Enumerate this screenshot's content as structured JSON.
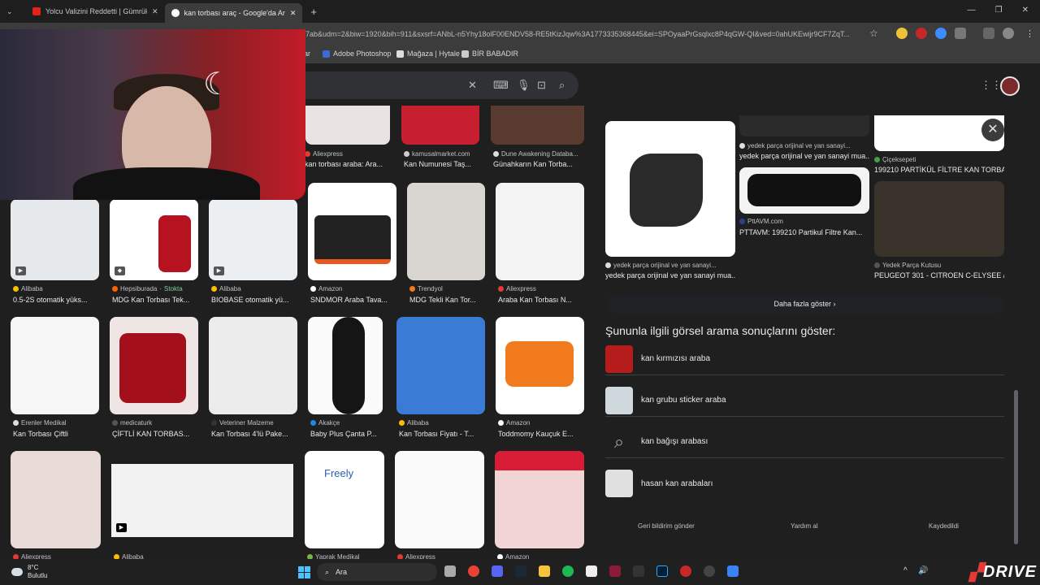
{
  "browser": {
    "tabs": [
      {
        "title": "Yolcu Valizini Reddetti | Gümrük"
      },
      {
        "title": "kan torbası araç - Google'da Ar"
      }
    ],
    "url_fragment": "d87ab&udm=2&biw=1920&bih=911&sxsrf=ANbL-n5Yhy18olF00ENDV58-RE5tKizJqw%3A1773335368445&ei=SPOyaaPrGsqlxc8P4qGW-QI&ved=0ahUKEwijr9CF7ZqT...",
    "bookmarks": [
      "lar",
      "Adobe Photoshop",
      "Mağaza | Hytale",
      "BİR BABADIR"
    ]
  },
  "results_row1": [
    {
      "source": "Aliexpress",
      "title": "kan torbası araba: Ara..."
    },
    {
      "source": "kamusalmarket.com",
      "title": "Kan Numunesi Taş..."
    },
    {
      "source": "Dune Awakening Databa...",
      "title": "Günahkarın Kan Torba..."
    }
  ],
  "results_row2": [
    {
      "source": "Alibaba",
      "title": "0.5-2S otomatik yüks..."
    },
    {
      "source": "Hepsiburada",
      "badge": "Stokta",
      "title": "MDG Kan Torbası Tek..."
    },
    {
      "source": "Alibaba",
      "title": "BIOBASE otomatik yü..."
    },
    {
      "source": "Amazon",
      "title": "SNDMOR Araba Tava..."
    },
    {
      "source": "Trendyol",
      "title": "MDG Tekli Kan Tor..."
    },
    {
      "source": "Aliexpress",
      "title": "Araba Kan Torbası N..."
    }
  ],
  "results_row3": [
    {
      "source": "Erenler Medikal",
      "title": "Kan Torbası Çiftli"
    },
    {
      "source": "medicaturk",
      "title": "ÇİFTLİ KAN TORBAS..."
    },
    {
      "source": "Veteriner Malzeme",
      "title": "Kan Torbası 4'lü Pake..."
    },
    {
      "source": "Akakçe",
      "title": "Baby Plus Çanta P..."
    },
    {
      "source": "Alibaba",
      "title": "Kan Torbası Fiyatı - T..."
    },
    {
      "source": "Amazon",
      "title": "Toddmomy Kauçuk E..."
    }
  ],
  "results_row4": [
    {
      "source": "Aliexpress"
    },
    {
      "source": "Alibaba"
    },
    {
      "source": "Yaprak Medikal"
    },
    {
      "source": "Aliexpress"
    },
    {
      "source": "Amazon"
    }
  ],
  "freely_label": "Freely",
  "panel": {
    "related_items": [
      {
        "source": "yedek parça orijinal ve yan sanayi...",
        "title": "yedek parça orijinal ve yan sanayi mua..."
      },
      {
        "source": "yedek parça orijinal ve yan sanayi...",
        "title": "yedek parça orijinal ve yan sanayi mua..."
      },
      {
        "source": "Çiçeksepeti",
        "title": "199210 PARTİKÜL FİLTRE KAN TORBASI..."
      },
      {
        "source": "PttAVM.com",
        "title": "PTTAVM: 199210 Partikul Filtre Kan..."
      },
      {
        "source": "Yedek Parça Kutusu",
        "title": "PEUGEOT 301 - CITROEN C-ELYSEE /..."
      }
    ],
    "more_button": "Daha fazla göster",
    "related_heading": "Şununla ilgili görsel arama sonuçlarını göster:",
    "related_searches": [
      "kan kırmızısı araba",
      "kan grubu sticker araba",
      "kan bağışı arabası",
      "hasan kan arabaları"
    ],
    "footer": [
      "Geri bildirim gönder",
      "Yardım al",
      "Kaydedildi"
    ]
  },
  "taskbar": {
    "temp": "8°C",
    "weather": "Bulutlu",
    "search": "Ara"
  },
  "overlay_logo": "DRIVE"
}
